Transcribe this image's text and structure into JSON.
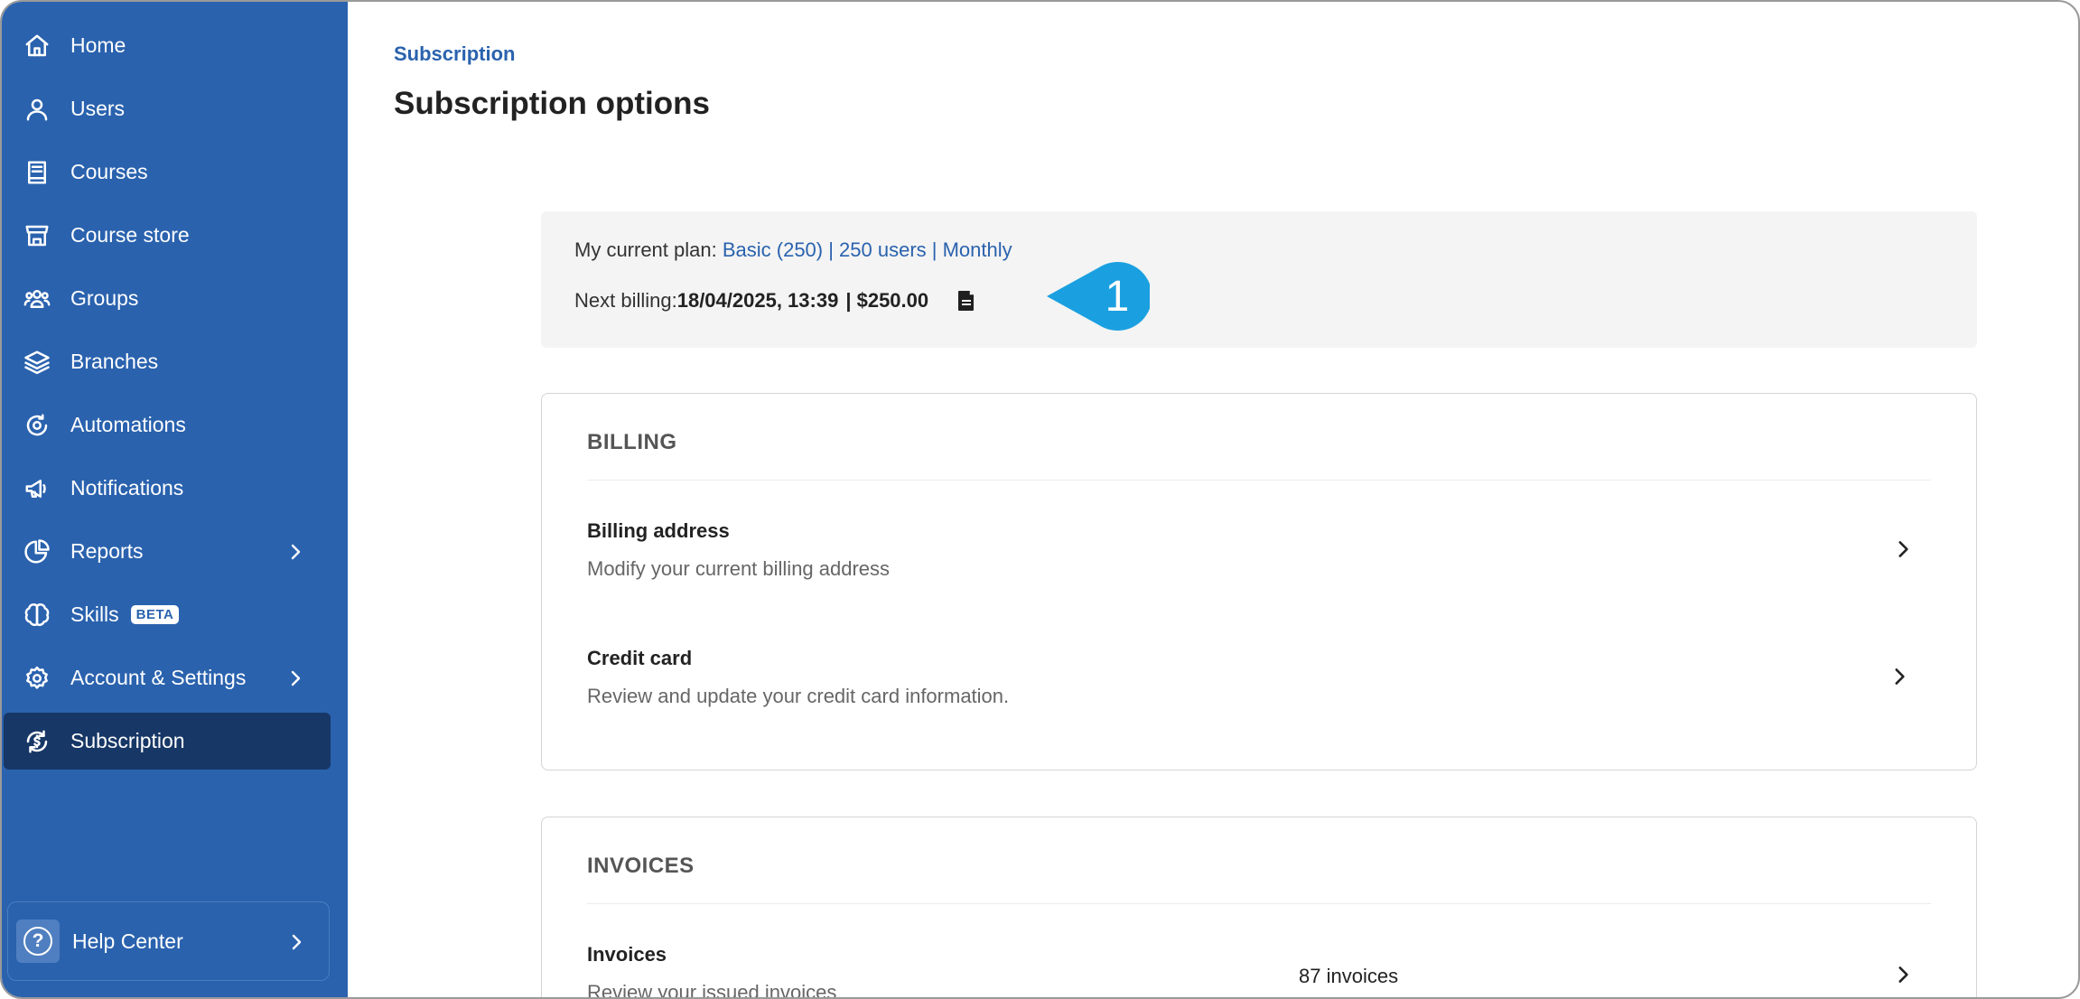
{
  "sidebar": {
    "items": [
      {
        "label": "Home",
        "icon": "home-icon"
      },
      {
        "label": "Users",
        "icon": "user-icon"
      },
      {
        "label": "Courses",
        "icon": "book-icon"
      },
      {
        "label": "Course store",
        "icon": "store-icon"
      },
      {
        "label": "Groups",
        "icon": "group-icon"
      },
      {
        "label": "Branches",
        "icon": "layers-icon"
      },
      {
        "label": "Automations",
        "icon": "automation-icon"
      },
      {
        "label": "Notifications",
        "icon": "megaphone-icon"
      },
      {
        "label": "Reports",
        "icon": "pie-chart-icon"
      },
      {
        "label": "Skills",
        "icon": "brain-icon",
        "badge": "BETA"
      },
      {
        "label": "Account & Settings",
        "icon": "gear-icon"
      },
      {
        "label": "Subscription",
        "icon": "subscription-icon"
      }
    ],
    "help": {
      "label": "Help Center",
      "icon": "question-icon"
    }
  },
  "header": {
    "breadcrumb": "Subscription",
    "title": "Subscription options"
  },
  "plan": {
    "label": "My current plan: ",
    "value": "Basic (250) | 250 users | Monthly",
    "next_billing_label": "Next billing: ",
    "next_billing_date": "18/04/2025, 13:39",
    "next_billing_amount": " | $250.00"
  },
  "callout": {
    "number": "1"
  },
  "billing": {
    "heading": "BILLING",
    "rows": [
      {
        "title": "Billing address",
        "subtitle": "Modify your current billing address"
      },
      {
        "title": "Credit card",
        "subtitle": "Review and update your credit card information."
      }
    ]
  },
  "invoices": {
    "heading": "INVOICES",
    "rows": [
      {
        "title": "Invoices",
        "subtitle": "Review your issued invoices",
        "meta": "87 invoices"
      }
    ]
  },
  "colors": {
    "sidebar_bg": "#2a62ae",
    "sidebar_active": "#173766",
    "accent": "#2a62ae",
    "callout": "#1aa0e0"
  }
}
